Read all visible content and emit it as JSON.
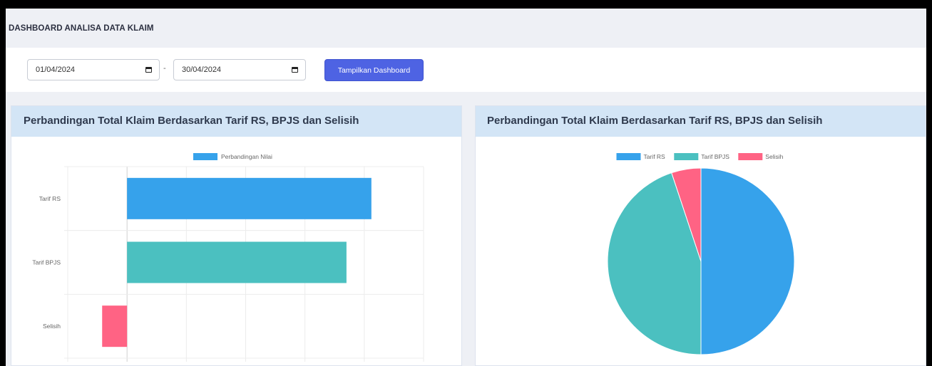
{
  "page": {
    "title": "DASHBOARD ANALISA DATA KLAIM"
  },
  "filter": {
    "start_date": "01/04/2024",
    "separator": "-",
    "end_date": "30/04/2024",
    "submit_label": "Tampilkan Dashboard",
    "button_color": "#4e63e3"
  },
  "cards": {
    "bar_title": "Perbandingan Total Klaim Berdasarkan Tarif RS, BPJS dan Selisih",
    "pie_title": "Perbandingan Total Klaim Berdasarkan Tarif RS, BPJS dan Selisih"
  },
  "chart_data": [
    {
      "type": "bar",
      "orientation": "horizontal",
      "legend": [
        "Perbandingan Nilai"
      ],
      "legend_position": "top",
      "categories": [
        "Tarif RS",
        "Tarif BPJS",
        "Selisih"
      ],
      "values": [
        20600000000,
        18500000000,
        -2100000000
      ],
      "colors": [
        "#36a2eb",
        "#4bc0c0",
        "#ff6384"
      ],
      "xlim": [
        -5000000000,
        25000000000
      ],
      "x_ticks": [
        "-5,000,000,000",
        "0",
        "5,000,000,000",
        "10,000,000,000",
        "15,000,000,000",
        "20,000,000,000",
        "25,000,000,000"
      ],
      "grid": true
    },
    {
      "type": "pie",
      "legend": [
        "Tarif RS",
        "Tarif BPJS",
        "Selisih"
      ],
      "legend_position": "top",
      "values": [
        20600000000,
        18500000000,
        2100000000
      ],
      "colors": [
        "#36a2eb",
        "#4bc0c0",
        "#ff6384"
      ]
    }
  ]
}
